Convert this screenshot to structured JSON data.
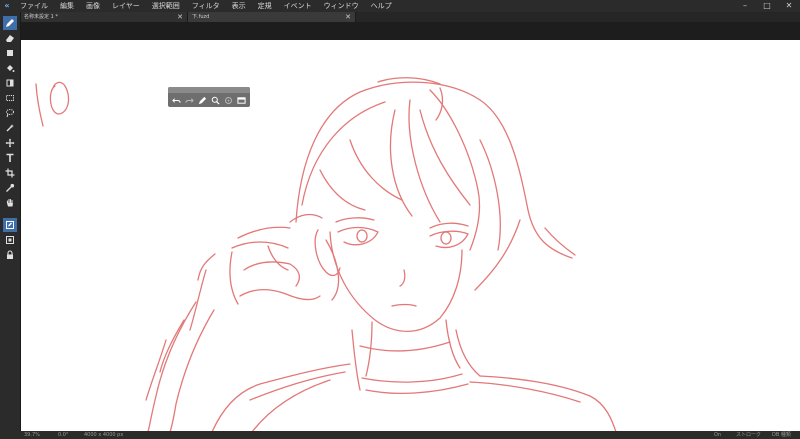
{
  "menu": [
    "ファイル",
    "編集",
    "画像",
    "レイヤー",
    "選択範囲",
    "フィルタ",
    "表示",
    "定規",
    "イベント",
    "ウィンドウ",
    "ヘルプ"
  ],
  "window_controls": {
    "minimize": "–",
    "maximize": "□",
    "close": "✕"
  },
  "tabs": [
    {
      "label": "名称未設定 1 *",
      "close": "✕"
    },
    {
      "label": "下.fuzd",
      "close": "✕"
    }
  ],
  "tools": [
    "pen-tool",
    "eraser-tool",
    "rectangle-tool",
    "fill-tool",
    "gradient-tool",
    "selection-tool",
    "lasso-tool",
    "magic-wand-tool",
    "move-tool",
    "text-tool",
    "crop-tool",
    "eyedropper-tool",
    "hand-tool",
    "layer-panel",
    "navigator-panel",
    "lock"
  ],
  "active_tool": "pen-tool",
  "floating_toolbar": [
    "undo",
    "redo",
    "pen",
    "zoom",
    "rotate",
    "fit"
  ],
  "status": {
    "zoom": "39.7%",
    "angle": "0.0°",
    "canvas_size": "4000 x 4000 px",
    "snap": "On",
    "layer": "ストローク",
    "mode": "DB 種類"
  },
  "colors": {
    "stroke": "#e06a6a",
    "accent": "#3f6fa8"
  }
}
